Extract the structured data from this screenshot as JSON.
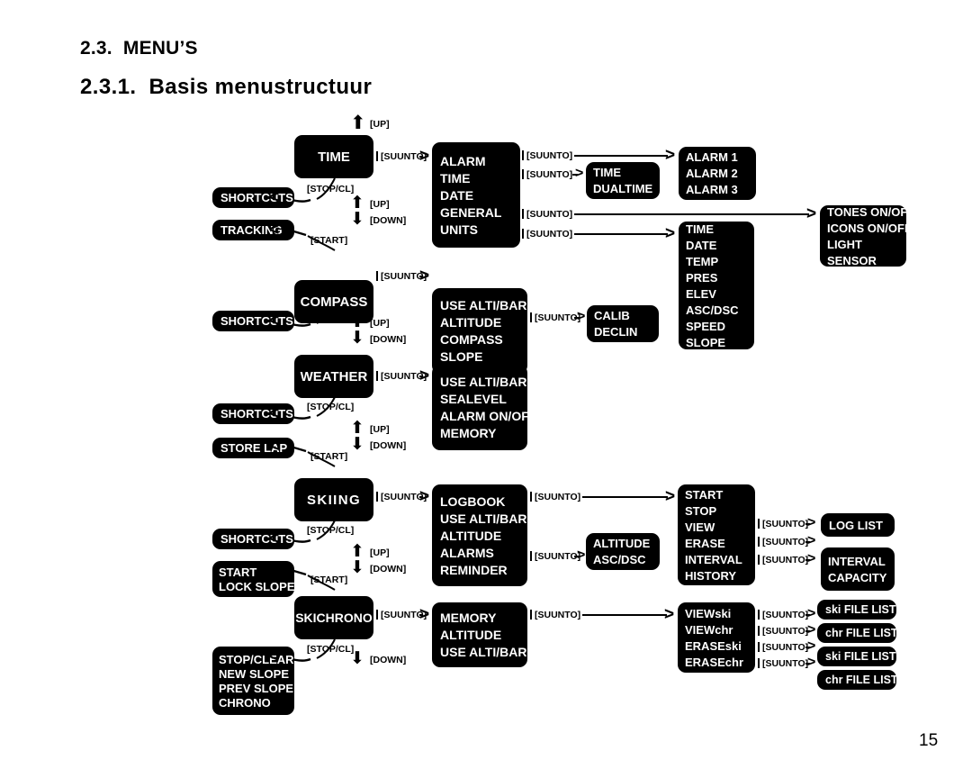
{
  "document": {
    "section_number": "2.3.",
    "section_title": "MENU’S",
    "subsection_number": "2.3.1.",
    "subsection_title": "Basis  menustructuur",
    "page_number": "15"
  },
  "labels": {
    "up": "[UP]",
    "down": "[DOWN]",
    "stop_cl": "[STOP/CL]",
    "start": "[START]",
    "suunto": "[SUUNTO]"
  },
  "modes": {
    "time": "TIME",
    "compass": "COMPASS",
    "weather": "WEATHER",
    "skiing": "SKIING",
    "skichrono": "SKICHRONO"
  },
  "shortcuts": {
    "time_shortcuts": "SHORTCUTS",
    "time_tracking": "TRACKING",
    "compass_shortcuts": "SHORTCUTS",
    "weather_shortcuts": "SHORTCUTS",
    "weather_store_lap": "STORE LAP",
    "skiing_shortcuts": "SHORTCUTS",
    "skiing_start": "START",
    "skiing_lock_slope": "LOCK SLOPE",
    "skichrono_stop_clear": "STOP/CLEAR",
    "skichrono_new_slope": "NEW SLOPE",
    "skichrono_prev_slope": "PREV SLOPE",
    "skichrono_chrono": "CHRONO"
  },
  "menus": {
    "time_menu": [
      "ALARM",
      "TIME",
      "DATE",
      "GENERAL",
      "UNITS"
    ],
    "time_dualtime": [
      "TIME",
      "DUALTIME"
    ],
    "alarms": [
      "ALARM 1",
      "ALARM  2",
      "ALARM 3"
    ],
    "general": [
      "TONES ON/OFF",
      "ICONS ON/OFF",
      "LIGHT",
      "SENSOR"
    ],
    "units": [
      "TIME",
      "DATE",
      "TEMP",
      "PRES",
      "ELEV",
      "ASC/DSC",
      "SPEED",
      "SLOPE"
    ],
    "compass_menu": [
      "USE ALTI/BARO",
      "ALTITUDE",
      "COMPASS",
      "SLOPE"
    ],
    "compass_calib": [
      "CALIB",
      "DECLIN"
    ],
    "weather_menu": [
      "USE ALTI/BARO",
      "SEALEVEL",
      "ALARM ON/OFF",
      "MEMORY"
    ],
    "skiing_menu": [
      "LOGBOOK",
      "USE ALTI/BARO",
      "ALTITUDE",
      "ALARMS",
      "REMINDER"
    ],
    "skiing_alarms": [
      "ALTITUDE",
      "ASC/DSC"
    ],
    "logbook": [
      "START",
      "STOP",
      "VIEW",
      "ERASE",
      "INTERVAL",
      "HISTORY"
    ],
    "log_list": [
      "LOG LIST"
    ],
    "interval_capacity": [
      "INTERVAL",
      "CAPACITY"
    ],
    "skichrono_menu": [
      "MEMORY",
      "ALTITUDE",
      "USE ALTI/BARO"
    ],
    "skichrono_memory": [
      "VIEWski",
      "VIEWchr",
      "ERASEski",
      "ERASEchr"
    ],
    "file_lists": [
      "ski FILE LIST",
      "chr FILE LIST",
      "ski FILE LIST",
      "chr FILE LIST"
    ]
  },
  "colors": {
    "box_fill": "#000000",
    "box_text": "#ffffff",
    "page_bg": "#ffffff"
  }
}
